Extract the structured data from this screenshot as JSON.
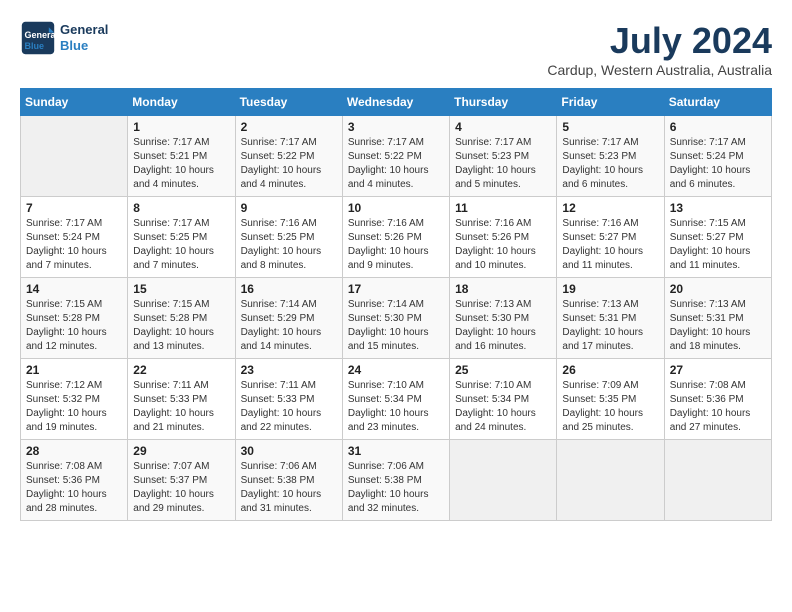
{
  "header": {
    "logo_line1": "General",
    "logo_line2": "Blue",
    "month_year": "July 2024",
    "location": "Cardup, Western Australia, Australia"
  },
  "weekdays": [
    "Sunday",
    "Monday",
    "Tuesday",
    "Wednesday",
    "Thursday",
    "Friday",
    "Saturday"
  ],
  "weeks": [
    [
      {
        "day": "",
        "info": ""
      },
      {
        "day": "1",
        "info": "Sunrise: 7:17 AM\nSunset: 5:21 PM\nDaylight: 10 hours\nand 4 minutes."
      },
      {
        "day": "2",
        "info": "Sunrise: 7:17 AM\nSunset: 5:22 PM\nDaylight: 10 hours\nand 4 minutes."
      },
      {
        "day": "3",
        "info": "Sunrise: 7:17 AM\nSunset: 5:22 PM\nDaylight: 10 hours\nand 4 minutes."
      },
      {
        "day": "4",
        "info": "Sunrise: 7:17 AM\nSunset: 5:23 PM\nDaylight: 10 hours\nand 5 minutes."
      },
      {
        "day": "5",
        "info": "Sunrise: 7:17 AM\nSunset: 5:23 PM\nDaylight: 10 hours\nand 6 minutes."
      },
      {
        "day": "6",
        "info": "Sunrise: 7:17 AM\nSunset: 5:24 PM\nDaylight: 10 hours\nand 6 minutes."
      }
    ],
    [
      {
        "day": "7",
        "info": "Sunrise: 7:17 AM\nSunset: 5:24 PM\nDaylight: 10 hours\nand 7 minutes."
      },
      {
        "day": "8",
        "info": "Sunrise: 7:17 AM\nSunset: 5:25 PM\nDaylight: 10 hours\nand 7 minutes."
      },
      {
        "day": "9",
        "info": "Sunrise: 7:16 AM\nSunset: 5:25 PM\nDaylight: 10 hours\nand 8 minutes."
      },
      {
        "day": "10",
        "info": "Sunrise: 7:16 AM\nSunset: 5:26 PM\nDaylight: 10 hours\nand 9 minutes."
      },
      {
        "day": "11",
        "info": "Sunrise: 7:16 AM\nSunset: 5:26 PM\nDaylight: 10 hours\nand 10 minutes."
      },
      {
        "day": "12",
        "info": "Sunrise: 7:16 AM\nSunset: 5:27 PM\nDaylight: 10 hours\nand 11 minutes."
      },
      {
        "day": "13",
        "info": "Sunrise: 7:15 AM\nSunset: 5:27 PM\nDaylight: 10 hours\nand 11 minutes."
      }
    ],
    [
      {
        "day": "14",
        "info": "Sunrise: 7:15 AM\nSunset: 5:28 PM\nDaylight: 10 hours\nand 12 minutes."
      },
      {
        "day": "15",
        "info": "Sunrise: 7:15 AM\nSunset: 5:28 PM\nDaylight: 10 hours\nand 13 minutes."
      },
      {
        "day": "16",
        "info": "Sunrise: 7:14 AM\nSunset: 5:29 PM\nDaylight: 10 hours\nand 14 minutes."
      },
      {
        "day": "17",
        "info": "Sunrise: 7:14 AM\nSunset: 5:30 PM\nDaylight: 10 hours\nand 15 minutes."
      },
      {
        "day": "18",
        "info": "Sunrise: 7:13 AM\nSunset: 5:30 PM\nDaylight: 10 hours\nand 16 minutes."
      },
      {
        "day": "19",
        "info": "Sunrise: 7:13 AM\nSunset: 5:31 PM\nDaylight: 10 hours\nand 17 minutes."
      },
      {
        "day": "20",
        "info": "Sunrise: 7:13 AM\nSunset: 5:31 PM\nDaylight: 10 hours\nand 18 minutes."
      }
    ],
    [
      {
        "day": "21",
        "info": "Sunrise: 7:12 AM\nSunset: 5:32 PM\nDaylight: 10 hours\nand 19 minutes."
      },
      {
        "day": "22",
        "info": "Sunrise: 7:11 AM\nSunset: 5:33 PM\nDaylight: 10 hours\nand 21 minutes."
      },
      {
        "day": "23",
        "info": "Sunrise: 7:11 AM\nSunset: 5:33 PM\nDaylight: 10 hours\nand 22 minutes."
      },
      {
        "day": "24",
        "info": "Sunrise: 7:10 AM\nSunset: 5:34 PM\nDaylight: 10 hours\nand 23 minutes."
      },
      {
        "day": "25",
        "info": "Sunrise: 7:10 AM\nSunset: 5:34 PM\nDaylight: 10 hours\nand 24 minutes."
      },
      {
        "day": "26",
        "info": "Sunrise: 7:09 AM\nSunset: 5:35 PM\nDaylight: 10 hours\nand 25 minutes."
      },
      {
        "day": "27",
        "info": "Sunrise: 7:08 AM\nSunset: 5:36 PM\nDaylight: 10 hours\nand 27 minutes."
      }
    ],
    [
      {
        "day": "28",
        "info": "Sunrise: 7:08 AM\nSunset: 5:36 PM\nDaylight: 10 hours\nand 28 minutes."
      },
      {
        "day": "29",
        "info": "Sunrise: 7:07 AM\nSunset: 5:37 PM\nDaylight: 10 hours\nand 29 minutes."
      },
      {
        "day": "30",
        "info": "Sunrise: 7:06 AM\nSunset: 5:38 PM\nDaylight: 10 hours\nand 31 minutes."
      },
      {
        "day": "31",
        "info": "Sunrise: 7:06 AM\nSunset: 5:38 PM\nDaylight: 10 hours\nand 32 minutes."
      },
      {
        "day": "",
        "info": ""
      },
      {
        "day": "",
        "info": ""
      },
      {
        "day": "",
        "info": ""
      }
    ]
  ]
}
